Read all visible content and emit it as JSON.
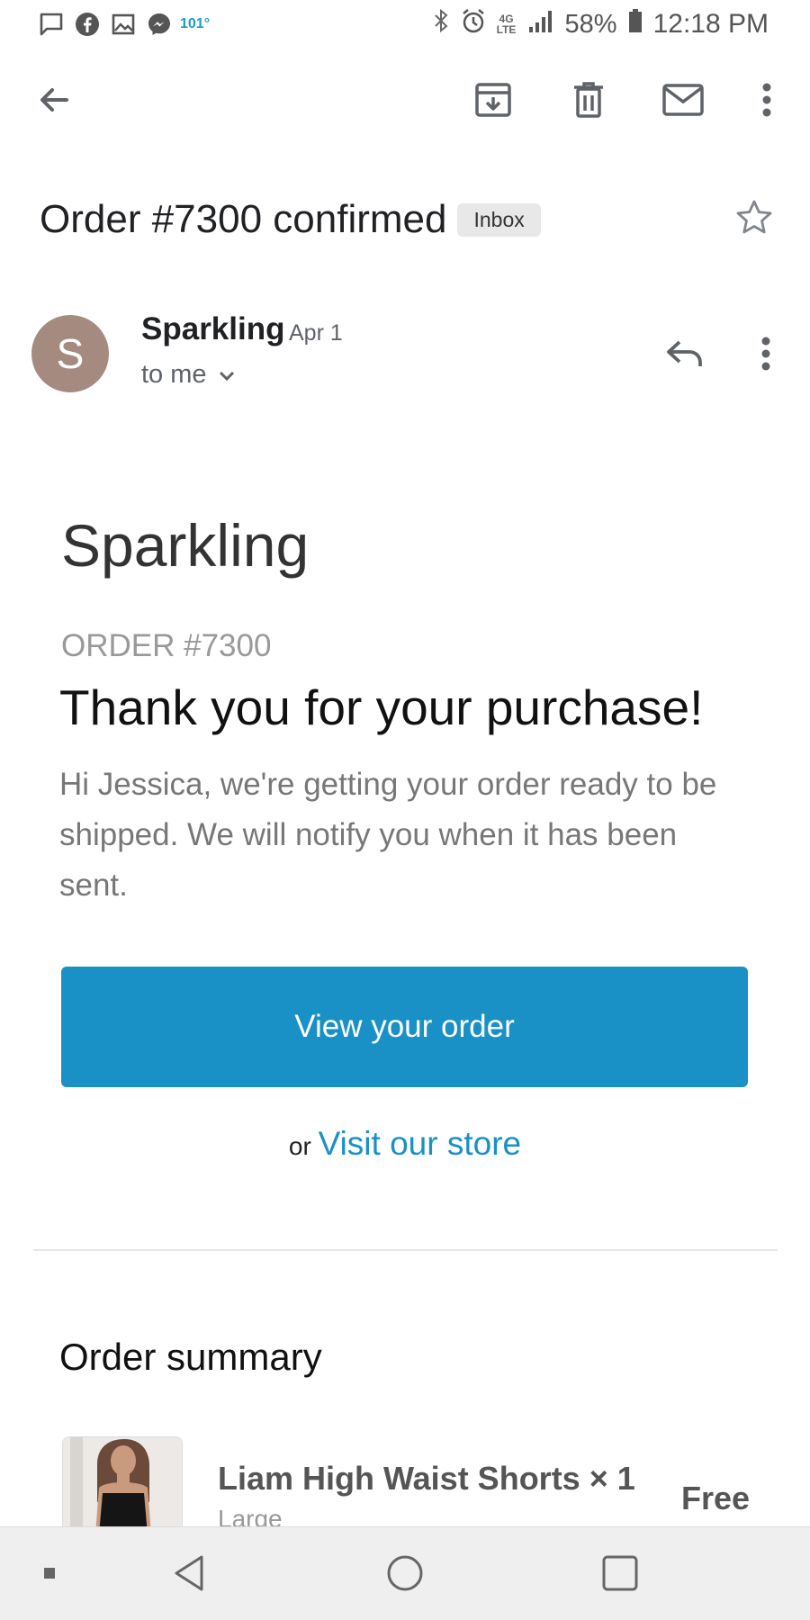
{
  "status_bar": {
    "temperature": "101°",
    "network": "4G LTE",
    "battery": "58%",
    "time": "12:18 PM",
    "icons": [
      "chat-icon",
      "facebook-icon",
      "gallery-icon",
      "messenger-icon",
      "bluetooth-icon",
      "alarm-icon",
      "signal-icon",
      "battery-icon"
    ]
  },
  "toolbar": {
    "icons": [
      "back-arrow-icon",
      "archive-icon",
      "delete-icon",
      "mark-unread-icon",
      "more-vert-icon"
    ]
  },
  "email": {
    "subject": "Order #7300 confirmed",
    "label": "Inbox",
    "sender": {
      "initial": "S",
      "name": "Sparkling",
      "date": "Apr 1",
      "recipient": "to me",
      "avatar_color": "#a58a80"
    }
  },
  "body": {
    "store_name": "Sparkling",
    "order_number": "ORDER #7300",
    "headline": "Thank you for your purchase!",
    "intro": "Hi Jessica, we're getting your order ready to be shipped. We will notify you when it has been sent.",
    "cta_label": "View your order",
    "or_text": "or",
    "store_link": "Visit our store",
    "accent_color": "#1990c6"
  },
  "summary": {
    "title": "Order summary",
    "items": [
      {
        "name": "Liam High Waist Shorts × 1",
        "variant": "Large",
        "price": "Free"
      }
    ]
  },
  "navbar": {
    "icons": [
      "recents-dot-icon",
      "back-triangle-icon",
      "home-circle-icon",
      "overview-square-icon"
    ]
  }
}
